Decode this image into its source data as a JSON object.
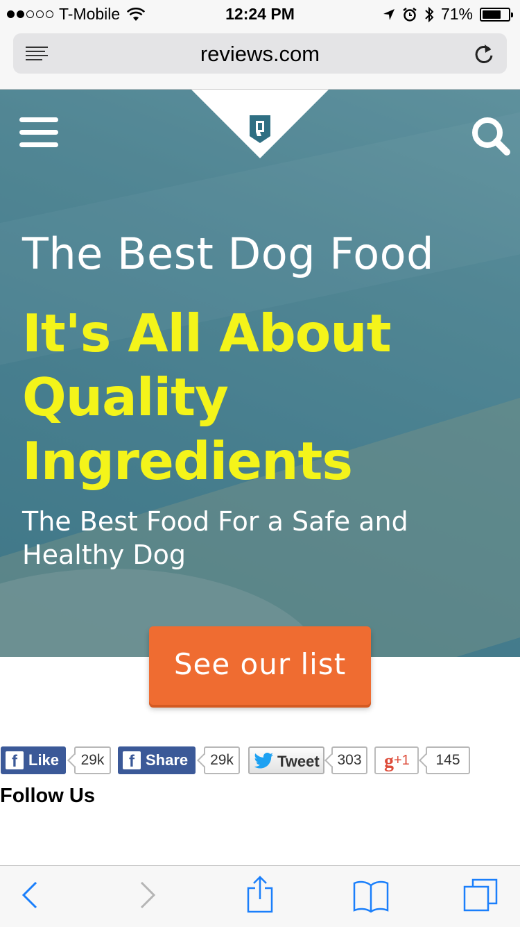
{
  "status_bar": {
    "carrier": "T-Mobile",
    "time": "12:24 PM",
    "battery_percent": "71%",
    "battery_level": 0.71,
    "signal_bars": 2,
    "signal_total": 5
  },
  "browser": {
    "url": "reviews.com"
  },
  "hero": {
    "title": "The Best Dog Food",
    "headline": "It's All About Quality Ingredients",
    "subtitle": "The Best Food For a Safe and Healthy Dog",
    "cta_label": "See our list"
  },
  "social": {
    "fb_like_label": "Like",
    "fb_like_count": "29k",
    "fb_share_label": "Share",
    "fb_share_count": "29k",
    "tweet_label": "Tweet",
    "tweet_count": "303",
    "gplus_label": "+1",
    "gplus_count": "145"
  },
  "follow_heading": "Follow Us",
  "colors": {
    "accent_yellow": "#f4f41a",
    "cta_orange": "#ef6c31",
    "facebook_blue": "#3b5998",
    "ios_blue": "#1a7ffb",
    "logo_teal": "#2f6f83"
  },
  "icons": [
    "reader-icon",
    "reload-icon",
    "hamburger-icon",
    "search-icon",
    "reviews-logo-icon",
    "back-icon",
    "forward-icon",
    "share-icon",
    "bookmarks-icon",
    "tabs-icon"
  ]
}
